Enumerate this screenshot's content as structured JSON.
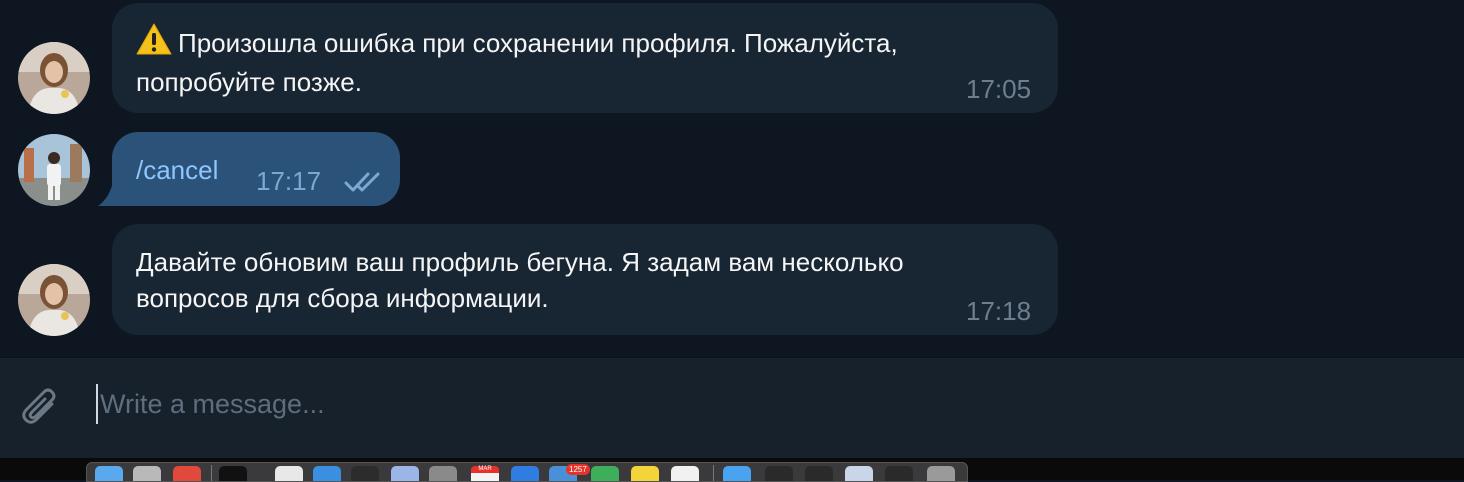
{
  "messages": [
    {
      "sender": "bot",
      "icon": "warning-icon",
      "lines": [
        "Произошла ошибка при сохранении профиля. Пожалуйста,",
        "попробуйте позже."
      ],
      "time": "17:05"
    },
    {
      "sender": "user",
      "text": "/cancel",
      "time": "17:17",
      "status": "read-double-check-icon"
    },
    {
      "sender": "bot",
      "lines": [
        "Давайте обновим ваш профиль бегуна. Я задам вам несколько",
        "вопросов для сбора информации."
      ],
      "time": "17:18"
    }
  ],
  "composer": {
    "placeholder": "Write a message...",
    "attach_icon": "paperclip-icon"
  },
  "dock": {
    "badge": "1257",
    "calendar_label": "MAR"
  },
  "colors": {
    "chat_background": "#0e1621",
    "incoming_bubble": "#182533",
    "outgoing_bubble": "#2b5278",
    "composer_background": "#17212b",
    "link_text": "#8fc6ff"
  }
}
